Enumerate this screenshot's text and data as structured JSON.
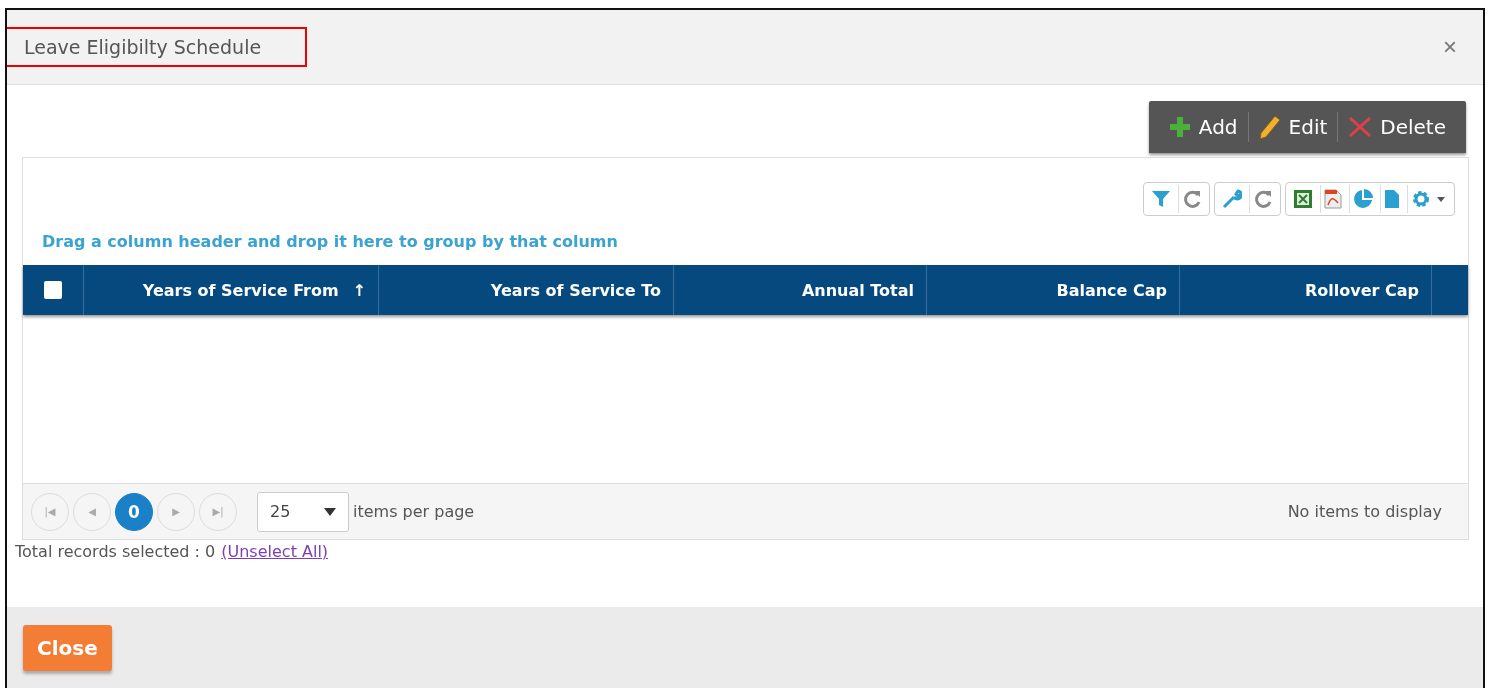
{
  "window": {
    "title": "Leave Eligibilty Schedule",
    "title_highlighted": true,
    "close": "×"
  },
  "actions": [
    {
      "kind": "add",
      "label": "Add"
    },
    {
      "kind": "edit",
      "label": "Edit"
    },
    {
      "kind": "delete",
      "label": "Delete"
    }
  ],
  "grid": {
    "tools": [
      {
        "kind": "filter"
      },
      {
        "kind": "refresh"
      },
      {
        "kind": "wrench"
      },
      {
        "kind": "refresh"
      },
      {
        "kind": "excel"
      },
      {
        "kind": "pdf"
      },
      {
        "kind": "chart"
      },
      {
        "kind": "file"
      },
      {
        "kind": "gear"
      }
    ],
    "group_hint": "Drag a column header and drop it here to group by that column",
    "select_all": {
      "checked": false
    },
    "columns": [
      {
        "label": "Years of Service From",
        "sort": "↑"
      },
      {
        "label": "Years of Service To"
      },
      {
        "label": "Annual Total"
      },
      {
        "label": "Balance Cap"
      },
      {
        "label": "Rollover Cap"
      }
    ],
    "pager": {
      "first": "|◀",
      "prev": "◀",
      "pages": [
        {
          "label": "0",
          "selected": true
        }
      ],
      "next": "▶",
      "last": "▶|",
      "page_size": "25",
      "page_size_label": "items per page",
      "status": "No items to display"
    }
  },
  "selection": {
    "text": "Total records selected : 0",
    "link": "(Unselect All)"
  },
  "footer": {
    "close": "Close"
  }
}
